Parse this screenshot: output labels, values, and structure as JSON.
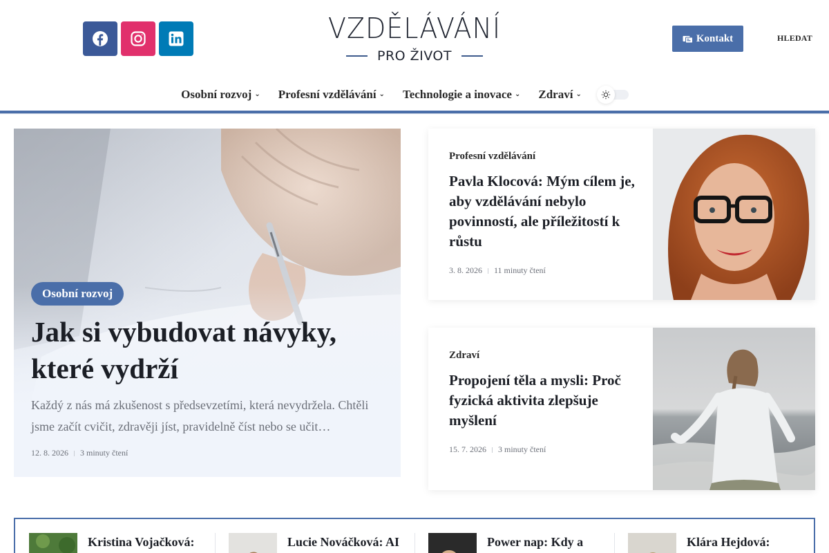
{
  "header": {
    "social": [
      {
        "name": "Facebook",
        "icon": "facebook-icon",
        "color": "#3b5998"
      },
      {
        "name": "Instagram",
        "icon": "instagram-icon",
        "color": "#e1306c"
      },
      {
        "name": "LinkedIn",
        "icon": "linkedin-icon",
        "color": "#007bb6"
      }
    ],
    "logo": {
      "main": "VZDĚLÁVÁNÍ",
      "sub": "PRO ŽIVOT"
    },
    "contact_label": "Kontakt",
    "search_label": "HLEDAT",
    "accent_color": "#4a6ea9"
  },
  "nav": {
    "items": [
      {
        "label": "Osobní rozvoj"
      },
      {
        "label": "Profesní vzdělávání"
      },
      {
        "label": "Technologie a inovace"
      },
      {
        "label": "Zdraví"
      }
    ],
    "theme_toggle_icon": "sun-icon"
  },
  "featured": {
    "category": "Osobní rozvoj",
    "title": "Jak si vybudovat návyky, které vydrží",
    "excerpt": "Každý z nás má zkušenost s předsevzetími, která nevydržela. Chtěli jsme začít cvičit, zdravěji jíst, pravidelně číst nebo se učit…",
    "date": "12. 8. 2026",
    "read_time": "3 minuty čtení"
  },
  "cards": [
    {
      "category": "Profesní vzdělávání",
      "title": "Pavla Klocová: Mým cílem je, aby vzdělávání nebylo povinností, ale příležitostí k růstu",
      "date": "3. 8. 2026",
      "read_time": "11 minuty čtení"
    },
    {
      "category": "Zdraví",
      "title": "Propojení těla a mysli: Proč fyzická aktivita zlepšuje myšlení",
      "date": "15. 7. 2026",
      "read_time": "3 minuty čtení"
    }
  ],
  "strip": {
    "items": [
      {
        "title": "Kristina Vojačková:"
      },
      {
        "title": "Lucie Nováčková: AI"
      },
      {
        "title": "Power nap: Kdy a"
      },
      {
        "title": "Klára Hejdová:"
      }
    ]
  }
}
